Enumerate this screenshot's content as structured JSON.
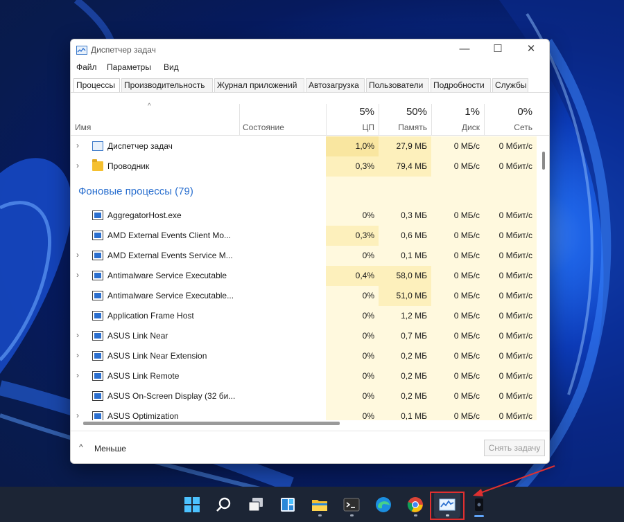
{
  "window": {
    "title": "Диспетчер задач",
    "controls": {
      "minimize": "—",
      "maximize": "☐",
      "close": "✕"
    }
  },
  "menu": [
    "Файл",
    "Параметры",
    "Вид"
  ],
  "tabs": [
    "Процессы",
    "Производительность",
    "Журнал приложений",
    "Автозагрузка",
    "Пользователи",
    "Подробности",
    "Службы"
  ],
  "active_tab": "Процессы",
  "columns": {
    "name": "Имя",
    "status": "Состояние",
    "cpu": {
      "pct": "5%",
      "label": "ЦП"
    },
    "memory": {
      "pct": "50%",
      "label": "Память"
    },
    "disk": {
      "pct": "1%",
      "label": "Диск"
    },
    "network": {
      "pct": "0%",
      "label": "Сеть"
    }
  },
  "apps": [
    {
      "name": "Диспетчер задач",
      "icon": "task-manager-icon",
      "expandable": true,
      "cpu": "1,0%",
      "mem": "27,9 МБ",
      "disk": "0 МБ/с",
      "net": "0 Мбит/с"
    },
    {
      "name": "Проводник",
      "icon": "folder-icon",
      "expandable": true,
      "cpu": "0,3%",
      "mem": "79,4 МБ",
      "disk": "0 МБ/с",
      "net": "0 Мбит/с"
    }
  ],
  "background_group_label": "Фоновые процессы (79)",
  "background": [
    {
      "name": "AggregatorHost.exe",
      "expandable": false,
      "cpu": "0%",
      "mem": "0,3 МБ",
      "disk": "0 МБ/с",
      "net": "0 Мбит/с"
    },
    {
      "name": "AMD External Events Client Mo...",
      "expandable": false,
      "cpu": "0,3%",
      "mem": "0,6 МБ",
      "disk": "0 МБ/с",
      "net": "0 Мбит/с"
    },
    {
      "name": "AMD External Events Service M...",
      "expandable": true,
      "cpu": "0%",
      "mem": "0,1 МБ",
      "disk": "0 МБ/с",
      "net": "0 Мбит/с"
    },
    {
      "name": "Antimalware Service Executable",
      "expandable": true,
      "cpu": "0,4%",
      "mem": "58,0 МБ",
      "disk": "0 МБ/с",
      "net": "0 Мбит/с"
    },
    {
      "name": "Antimalware Service Executable...",
      "expandable": false,
      "cpu": "0%",
      "mem": "51,0 МБ",
      "disk": "0 МБ/с",
      "net": "0 Мбит/с"
    },
    {
      "name": "Application Frame Host",
      "expandable": false,
      "cpu": "0%",
      "mem": "1,2 МБ",
      "disk": "0 МБ/с",
      "net": "0 Мбит/с"
    },
    {
      "name": "ASUS Link Near",
      "expandable": true,
      "cpu": "0%",
      "mem": "0,7 МБ",
      "disk": "0 МБ/с",
      "net": "0 Мбит/с"
    },
    {
      "name": "ASUS Link Near Extension",
      "expandable": true,
      "cpu": "0%",
      "mem": "0,2 МБ",
      "disk": "0 МБ/с",
      "net": "0 Мбит/с"
    },
    {
      "name": "ASUS Link Remote",
      "expandable": true,
      "cpu": "0%",
      "mem": "0,2 МБ",
      "disk": "0 МБ/с",
      "net": "0 Мбит/с"
    },
    {
      "name": "ASUS On-Screen Display (32 би...",
      "expandable": false,
      "cpu": "0%",
      "mem": "0,2 МБ",
      "disk": "0 МБ/с",
      "net": "0 Мбит/с"
    },
    {
      "name": "ASUS Optimization",
      "expandable": true,
      "cpu": "0%",
      "mem": "0,1 МБ",
      "disk": "0 МБ/с",
      "net": "0 Мбит/с"
    }
  ],
  "footer": {
    "less_label": "Меньше",
    "end_task_label": "Снять задачу"
  },
  "taskbar": {
    "items": [
      "start-icon",
      "search-icon",
      "task-view-icon",
      "widgets-icon",
      "file-explorer-icon",
      "terminal-icon",
      "edge-icon",
      "chrome-icon",
      "task-manager-icon",
      "camera-app-icon"
    ],
    "highlighted": "task-manager-icon"
  },
  "colors": {
    "heat_light": "#fff9de",
    "heat_medium": "#fdf0bc",
    "heat_strong": "#f9e6a0",
    "group_label": "#2a6fcf",
    "highlight_border": "#e03030",
    "taskbar": "#1c2535"
  }
}
